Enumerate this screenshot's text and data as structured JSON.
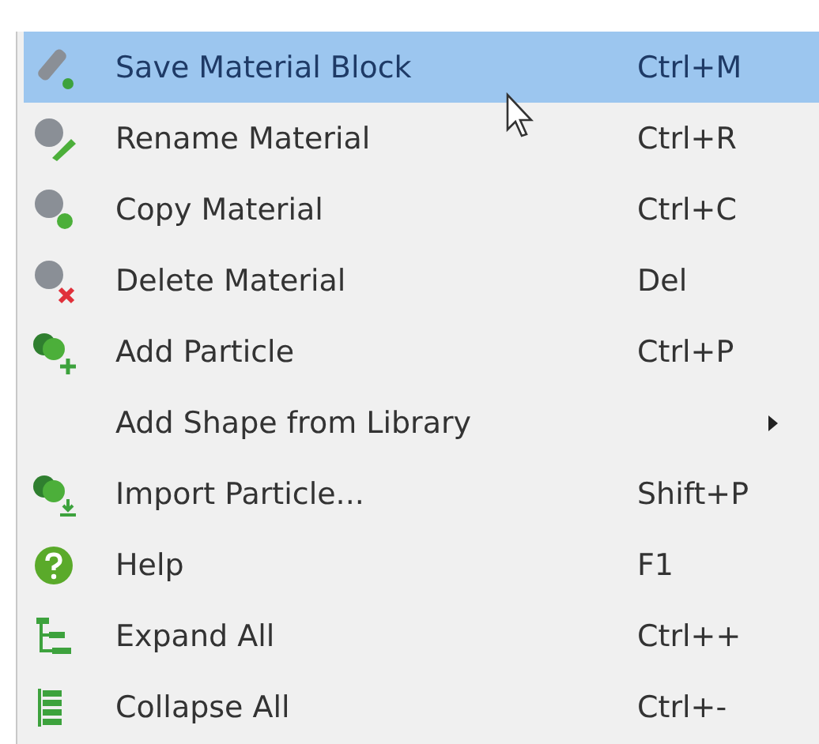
{
  "menu": {
    "items": [
      {
        "label": "Save Material Block",
        "shortcut": "Ctrl+M",
        "selected": true,
        "submenu": false
      },
      {
        "label": "Rename Material",
        "shortcut": "Ctrl+R",
        "selected": false,
        "submenu": false
      },
      {
        "label": "Copy Material",
        "shortcut": "Ctrl+C",
        "selected": false,
        "submenu": false
      },
      {
        "label": "Delete Material",
        "shortcut": "Del",
        "selected": false,
        "submenu": false
      },
      {
        "label": "Add Particle",
        "shortcut": "Ctrl+P",
        "selected": false,
        "submenu": false
      },
      {
        "label": "Add Shape from Library",
        "selected": false,
        "submenu": true
      },
      {
        "label": "Import Particle...",
        "shortcut": "Shift+P",
        "selected": false,
        "submenu": false
      },
      {
        "label": "Help",
        "shortcut": "F1",
        "selected": false,
        "submenu": false
      },
      {
        "label": "Expand All",
        "shortcut": "Ctrl++",
        "selected": false,
        "submenu": false
      },
      {
        "label": "Collapse All",
        "shortcut": "Ctrl+-",
        "selected": false,
        "submenu": false
      }
    ]
  }
}
